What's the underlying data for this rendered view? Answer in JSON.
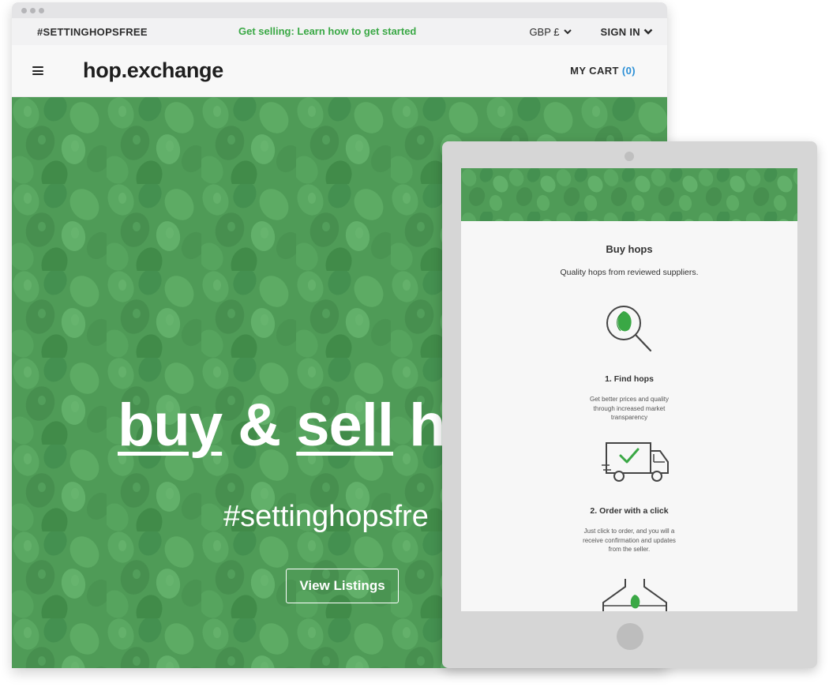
{
  "desktop": {
    "utility_bar": {
      "hashtag": "#SETTINGHOPSFREE",
      "promo_link": "Get selling: Learn how to get started",
      "currency": "GBP £",
      "sign_in": "SIGN IN"
    },
    "header": {
      "menu_icon": "hamburger-menu-icon",
      "logo": "hop.exchange",
      "cart_label": "MY CART",
      "cart_count": "(0)"
    },
    "hero": {
      "headline_buy": "buy",
      "headline_amp": "&",
      "headline_sell": "sell",
      "headline_tail": "h",
      "tagline": "#settinghopsfre",
      "cta": "View Listings"
    }
  },
  "tablet": {
    "section_title": "Buy hops",
    "section_subtitle": "Quality hops from reviewed suppliers.",
    "steps": [
      {
        "icon": "magnifier-hop-icon",
        "title": "1. Find hops",
        "desc_lines": [
          "Get better prices and quality",
          "through increased market",
          "transparency"
        ]
      },
      {
        "icon": "delivery-truck-check-icon",
        "title": "2. Order with a click",
        "desc_lines": [
          "Just click to order, and you will a",
          "receive confirmation and updates",
          "from the seller."
        ]
      },
      {
        "icon": "hop-press-icon"
      }
    ]
  },
  "colors": {
    "brand_green": "#3aa845",
    "hero_green": "#4f9b57",
    "cart_count_blue": "#2b8fd6"
  }
}
